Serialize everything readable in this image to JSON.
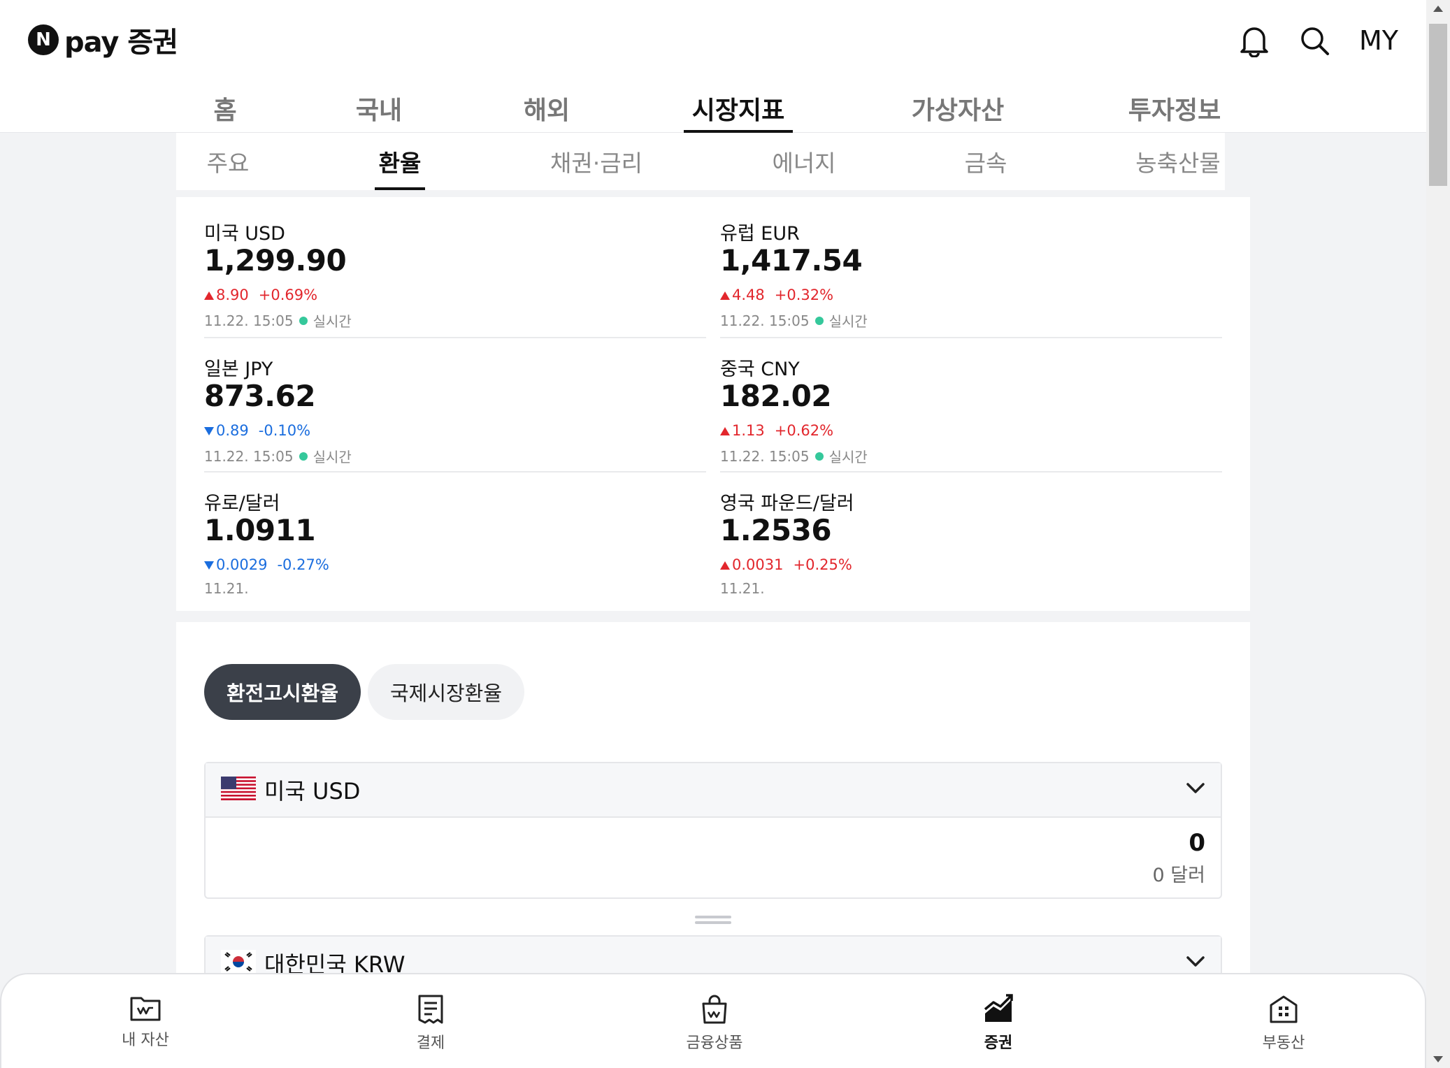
{
  "header": {
    "logo_badge": "N",
    "logo_text": "pay 증권",
    "my_label": "MY",
    "icons": [
      "bell-icon",
      "search-icon"
    ]
  },
  "main_tabs": [
    "홈",
    "국내",
    "해외",
    "시장지표",
    "가상자산",
    "투자정보"
  ],
  "main_tab_active": "시장지표",
  "sub_tabs": [
    "주요",
    "환율",
    "채권·금리",
    "에너지",
    "금속",
    "농축산물"
  ],
  "sub_tab_active": "환율",
  "rates": [
    {
      "name": "미국 USD",
      "value": "1,299.90",
      "direction": "up",
      "change": "8.90",
      "percent": "+0.69%",
      "time": "11.22. 15:05",
      "realtime": "실시간"
    },
    {
      "name": "유럽 EUR",
      "value": "1,417.54",
      "direction": "up",
      "change": "4.48",
      "percent": "+0.32%",
      "time": "11.22. 15:05",
      "realtime": "실시간"
    },
    {
      "name": "일본 JPY",
      "value": "873.62",
      "direction": "down",
      "change": "0.89",
      "percent": "-0.10%",
      "time": "11.22. 15:05",
      "realtime": "실시간"
    },
    {
      "name": "중국 CNY",
      "value": "182.02",
      "direction": "up",
      "change": "1.13",
      "percent": "+0.62%",
      "time": "11.22. 15:05",
      "realtime": "실시간"
    },
    {
      "name": "유로/달러",
      "value": "1.0911",
      "direction": "down",
      "change": "0.0029",
      "percent": "-0.27%",
      "time": "11.21.",
      "realtime": ""
    },
    {
      "name": "영국 파운드/달러",
      "value": "1.2536",
      "direction": "up",
      "change": "0.0031",
      "percent": "+0.25%",
      "time": "11.21.",
      "realtime": ""
    }
  ],
  "converter": {
    "chips": [
      "환전고시환율",
      "국제시장환율"
    ],
    "chip_active": "환전고시환율",
    "from": {
      "flag": "us-flag",
      "name": "미국 USD",
      "amount": "0",
      "unit": "0 달러"
    },
    "to": {
      "flag": "kr-flag",
      "name": "대한민국 KRW"
    }
  },
  "bottom_nav": [
    {
      "label": "내 자산",
      "icon": "wallet-icon"
    },
    {
      "label": "결제",
      "icon": "receipt-icon"
    },
    {
      "label": "금융상품",
      "icon": "shopping-bag-icon"
    },
    {
      "label": "증권",
      "icon": "stock-chart-icon",
      "active": true
    },
    {
      "label": "부동산",
      "icon": "building-icon"
    }
  ],
  "colors": {
    "up": "#e2262c",
    "down": "#1a6dde",
    "realtime_dot": "#35c89b",
    "chip_active_bg": "#3b4049"
  }
}
